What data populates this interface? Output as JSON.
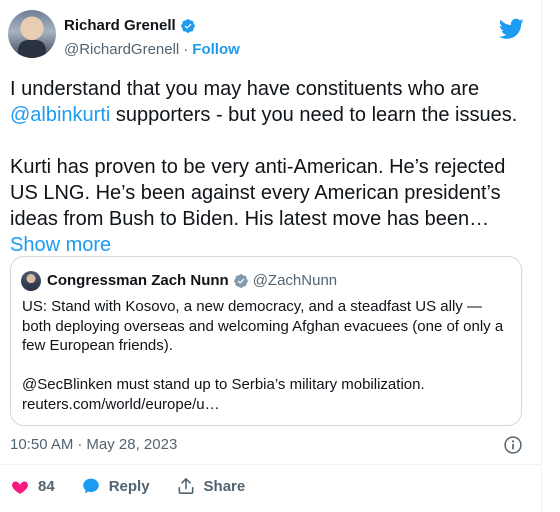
{
  "author": {
    "name": "Richard Grenell",
    "handle": "@RichardGrenell",
    "separator": "·",
    "follow_label": "Follow"
  },
  "tweet": {
    "para1_pre": "I understand that you may have constituents who are ",
    "para1_mention": "@albinkurti",
    "para1_post": " supporters - but you need to learn the issues.",
    "para2_text": "Kurti has proven to be very anti-American. He’s rejected US LNG. He’s been against every American president’s ideas from Bush to Biden. His latest move has been… ",
    "show_more": "Show more"
  },
  "quote": {
    "name": "Congressman Zach Nunn",
    "handle": "@ZachNunn",
    "para1": "US: Stand with Kosovo, a new democracy, and a steadfast US ally — both deploying overseas and welcoming Afghan evacuees (one of only a few European friends).",
    "para2_line1": "@SecBlinken must stand up to Serbia’s military mobilization.",
    "para2_line2": "reuters.com/world/europe/u…"
  },
  "meta": {
    "time": "10:50 AM",
    "separator": "·",
    "date": "May 28, 2023"
  },
  "actions": {
    "like_count": "84",
    "reply_label": "Reply",
    "share_label": "Share"
  },
  "colors": {
    "accent": "#1d9bf0",
    "like": "#f91880",
    "text": "#0f1419",
    "muted": "#536471",
    "border": "#cfd9de"
  },
  "icons": [
    "verified-badge-icon",
    "twitter-bird-icon",
    "info-icon",
    "heart-icon",
    "reply-bubble-icon",
    "share-icon"
  ]
}
